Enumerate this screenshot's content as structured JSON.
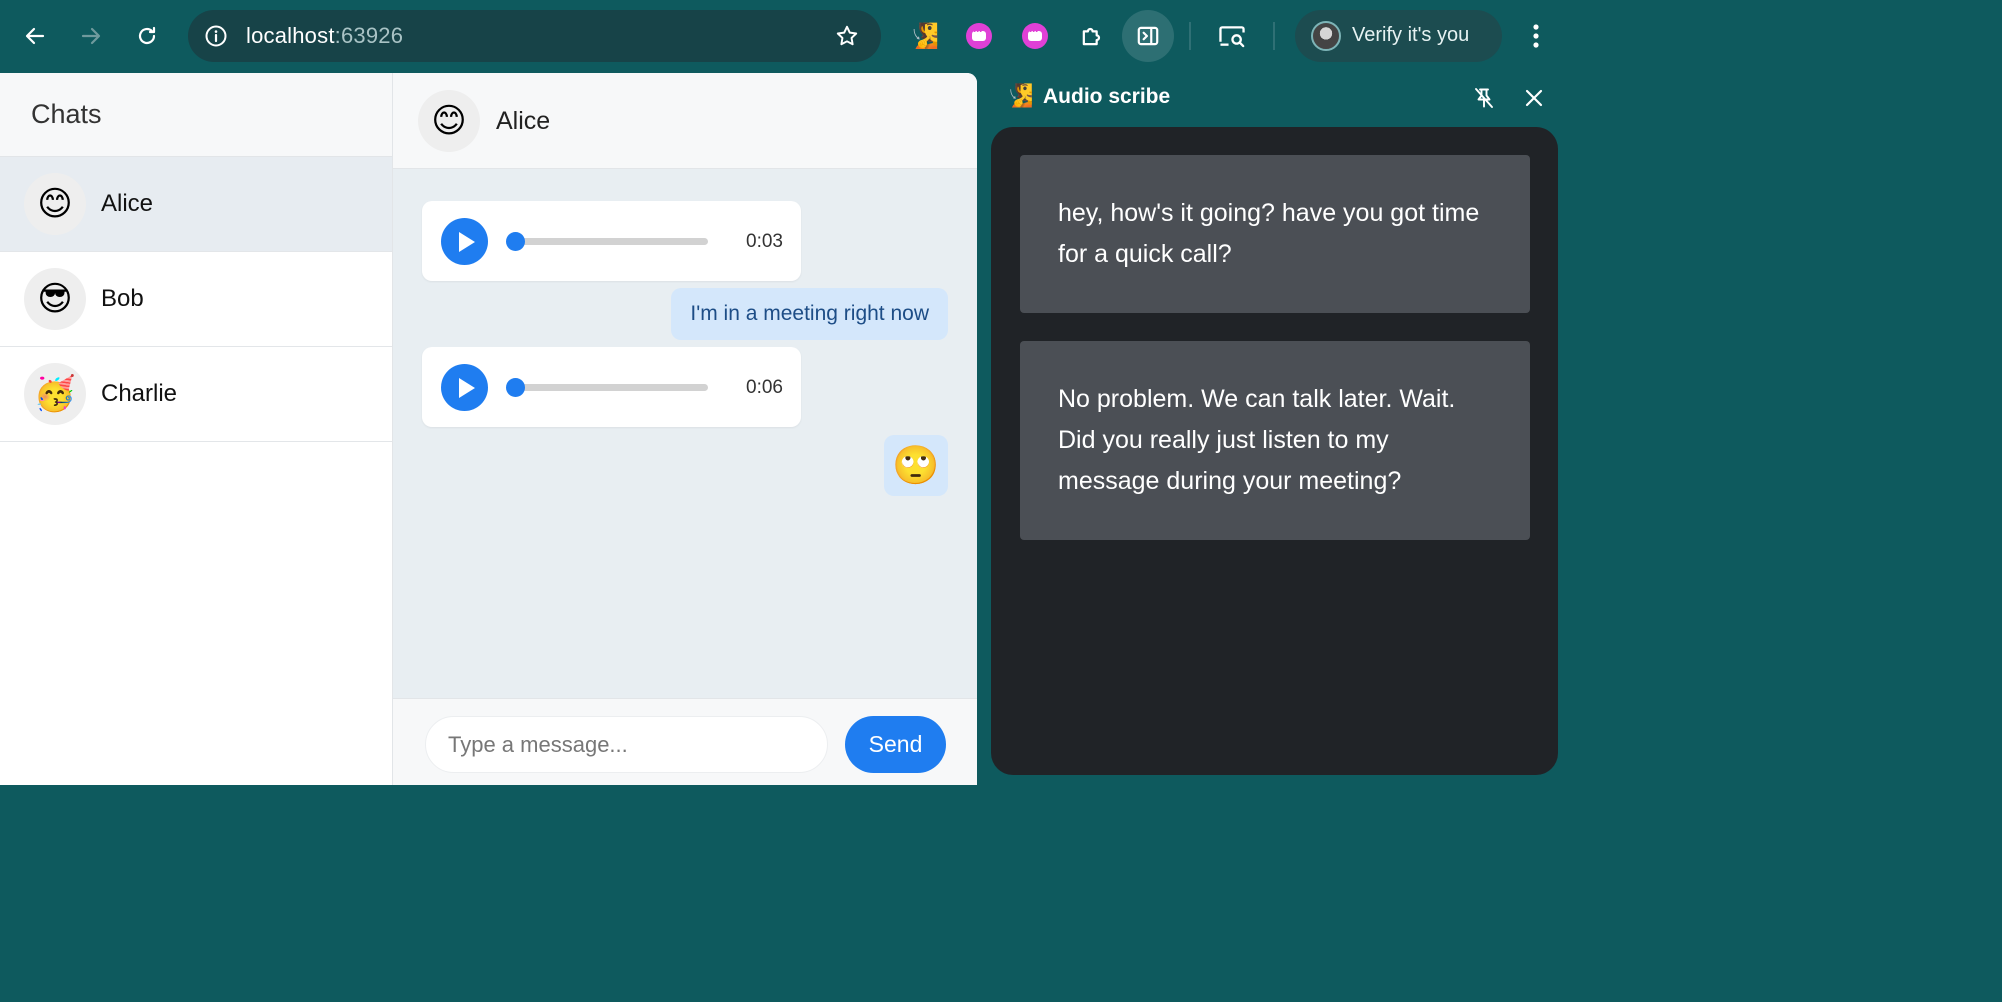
{
  "browser": {
    "url_host": "localhost",
    "url_port": ":63926",
    "profile_label": "Verify it's you"
  },
  "chat_list": {
    "title": "Chats",
    "items": [
      {
        "name": "Alice",
        "emoji": "😊",
        "active": true
      },
      {
        "name": "Bob",
        "emoji": "😎",
        "active": false
      },
      {
        "name": "Charlie",
        "emoji": "🥳",
        "active": false
      }
    ]
  },
  "conversation": {
    "contact_name": "Alice",
    "contact_emoji": "😊",
    "messages": [
      {
        "type": "audio",
        "duration": "0:03"
      },
      {
        "type": "text",
        "text": "I'm in a meeting right now"
      },
      {
        "type": "audio",
        "duration": "0:06"
      },
      {
        "type": "emoji",
        "text": "🙄"
      }
    ],
    "composer": {
      "placeholder": "Type a message...",
      "send_label": "Send"
    }
  },
  "side_panel": {
    "title": "Audio scribe",
    "ext_emoji": "🧏",
    "transcripts": [
      "hey, how's it going? have you got time for a quick call?",
      "No problem. We can talk later. Wait. Did you really just listen to my message during your meeting?"
    ]
  },
  "colors": {
    "frame": "#0e5a5e",
    "accent": "#1f7df0",
    "bubble": "#d4e7fb"
  }
}
